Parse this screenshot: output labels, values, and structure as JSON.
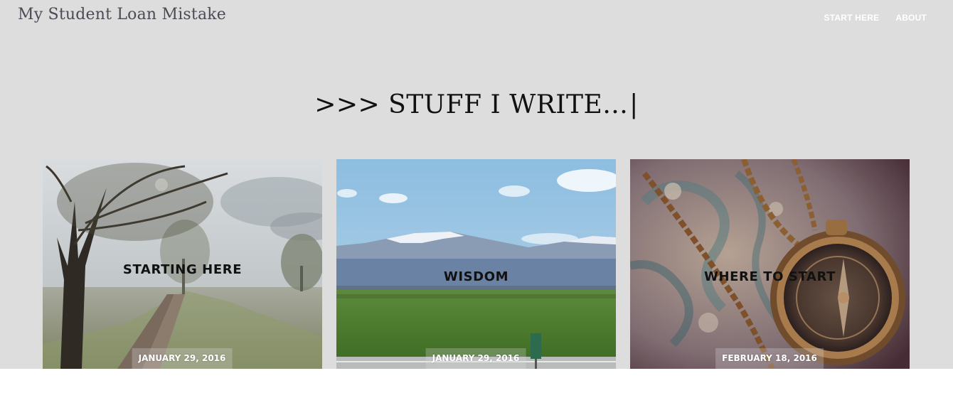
{
  "header": {
    "site_title": "My Student Loan Mistake",
    "nav": [
      {
        "label": "START HERE"
      },
      {
        "label": "ABOUT"
      }
    ]
  },
  "section": {
    "heading": ">>> STUFF I WRITE...",
    "cursor": "|"
  },
  "posts": [
    {
      "title": "STARTING HERE",
      "date": "JANUARY 29, 2016",
      "image": "misty-tree-path-photo"
    },
    {
      "title": "WISDOM",
      "date": "JANUARY 29, 2016",
      "image": "mountain-field-photo"
    },
    {
      "title": "WHERE TO START",
      "date": "FEBRUARY 18, 2016",
      "image": "compass-chain-photo"
    }
  ],
  "colors": {
    "hero_background": "#dddddd",
    "site_title": "#4d4a55",
    "nav_text": "#ffffff"
  }
}
